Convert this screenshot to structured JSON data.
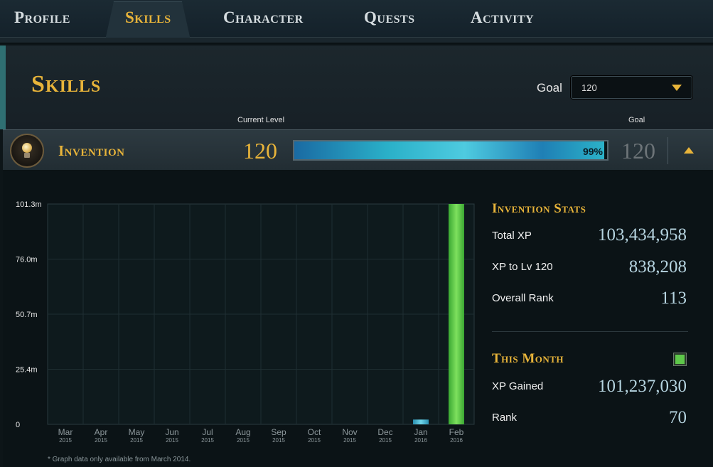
{
  "nav": {
    "tabs": [
      {
        "label": "Profile"
      },
      {
        "label": "Skills"
      },
      {
        "label": "Character"
      },
      {
        "label": "Quests"
      },
      {
        "label": "Activity"
      }
    ],
    "active": "Skills"
  },
  "header": {
    "title": "Skills",
    "goal_label": "Goal",
    "goal_value": "120",
    "col_current_level": "Current Level",
    "col_goal": "Goal"
  },
  "skill": {
    "name": "Invention",
    "icon": "lightbulb-icon",
    "current_level": "120",
    "progress_pct": 99,
    "progress_text": "99%",
    "goal_level": "120"
  },
  "chart_data": {
    "type": "bar",
    "categories": [
      "Mar",
      "Apr",
      "May",
      "Jun",
      "Jul",
      "Aug",
      "Sep",
      "Oct",
      "Nov",
      "Dec",
      "Jan",
      "Feb"
    ],
    "years": [
      "2015",
      "2015",
      "2015",
      "2015",
      "2015",
      "2015",
      "2015",
      "2015",
      "2015",
      "2015",
      "2016",
      "2016"
    ],
    "values": [
      0,
      0,
      0,
      0,
      0,
      0,
      0,
      0,
      0,
      0,
      2.2,
      101.3
    ],
    "bar_colors": [
      "#3fb7d6",
      "#3fb7d6",
      "#3fb7d6",
      "#3fb7d6",
      "#3fb7d6",
      "#3fb7d6",
      "#3fb7d6",
      "#3fb7d6",
      "#3fb7d6",
      "#3fb7d6",
      "#3fb7d6",
      "#5ec84a"
    ],
    "y_ticks": [
      "0",
      "25.4m",
      "50.7m",
      "76.0m",
      "101.3m"
    ],
    "ylim": [
      0,
      101.3
    ],
    "grid": true
  },
  "footnote": "* Graph data only available from March 2014.",
  "stats": {
    "title": "Invention Stats",
    "total_xp_label": "Total XP",
    "total_xp_value": "103,434,958",
    "xp_to_label": "XP to Lv 120",
    "xp_to_value": "838,208",
    "rank_label": "Overall Rank",
    "rank_value": "113",
    "month_title": "This Month",
    "month_color": "#5ec84a",
    "xp_gained_label": "XP Gained",
    "xp_gained_value": "101,237,030",
    "month_rank_label": "Rank",
    "month_rank_value": "70"
  }
}
